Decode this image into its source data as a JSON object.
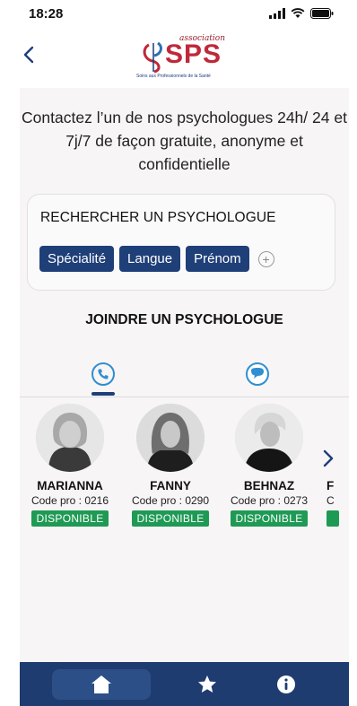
{
  "status_bar": {
    "time": "18:28"
  },
  "header": {
    "logo_association": "association",
    "logo_name": "SPS",
    "logo_tagline": "Soins aux Professionnels de la Santé"
  },
  "intro_text": "Contactez l’un de nos psychologues 24h/ 24 et 7j/7 de façon gratuite, anonyme et confidentielle",
  "search": {
    "title": "RECHERCHER UN PSYCHOLOGUE",
    "filters": [
      "Spécialité",
      "Langue",
      "Prénom"
    ]
  },
  "join_title": "JOINDRE UN PSYCHOLOGUE",
  "tabs": [
    {
      "icon": "phone-icon",
      "active": true
    },
    {
      "icon": "chat-icon",
      "active": false
    }
  ],
  "psychologists": [
    {
      "name": "MARIANNA",
      "code": "Code pro : 0216",
      "status": "DISPONIBLE"
    },
    {
      "name": "FANNY",
      "code": "Code pro : 0290",
      "status": "DISPONIBLE"
    },
    {
      "name": "BEHNAZ",
      "code": "Code pro : 0273",
      "status": "DISPONIBLE"
    },
    {
      "name": "F",
      "code": "C",
      "status": ""
    }
  ],
  "bottom_nav": [
    {
      "icon": "home-icon",
      "active": true
    },
    {
      "icon": "star-icon",
      "active": false
    },
    {
      "icon": "info-icon",
      "active": false
    }
  ],
  "colors": {
    "primary": "#1f3f78",
    "available": "#1f9a55",
    "accent": "#2f8fd0",
    "logo_red": "#c0283a"
  }
}
